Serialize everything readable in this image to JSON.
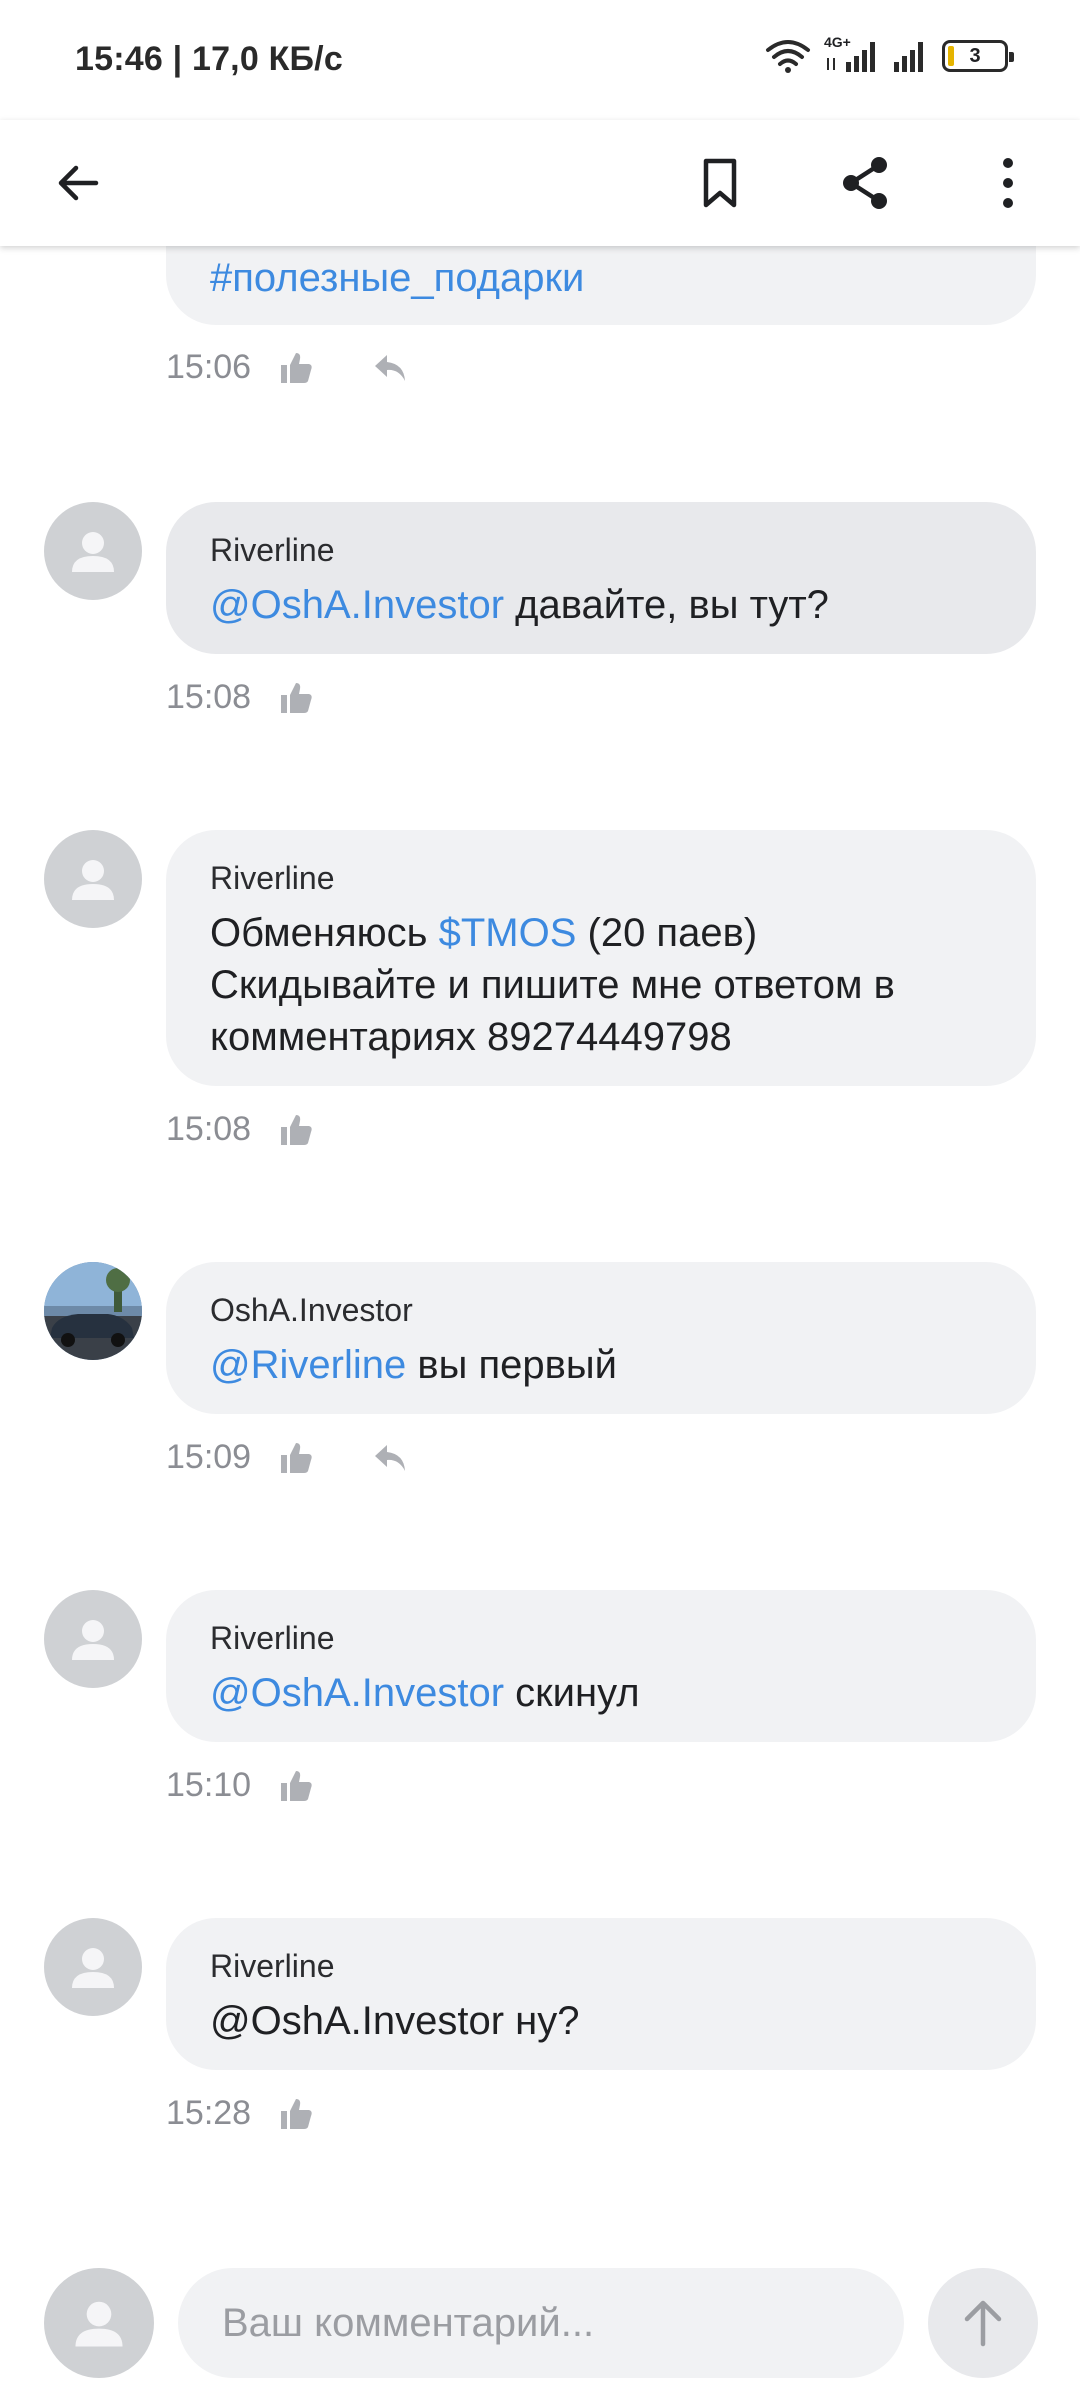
{
  "status_bar": {
    "time_speed": "15:46 | 17,0 КБ/с",
    "network": "4G+",
    "battery": "3"
  },
  "toolbar": {
    "back_icon": "arrow-left-icon",
    "bookmark_icon": "bookmark-icon",
    "share_icon": "share-icon",
    "more_icon": "more-vertical-icon"
  },
  "top_partial": {
    "hashtag": "#полезные_подарки",
    "time": "15:06"
  },
  "comments": [
    {
      "author": "Riverline",
      "mention": "@OshA.Investor",
      "text": " давайте, вы тут?",
      "time": "15:08"
    },
    {
      "author": "Riverline",
      "pre": "Обменяюсь ",
      "ticker": "$TMOS",
      "post": " (20 паев) Скидывайте и пишите мне ответом в комментариях 89274449798",
      "time": "15:08"
    },
    {
      "author": "OshA.Investor",
      "mention": "@Riverline",
      "text": " вы первый",
      "time": "15:09"
    },
    {
      "author": "Riverline",
      "mention": "@OshA.Investor",
      "text": " скинул",
      "time": "15:10"
    },
    {
      "author": "Riverline",
      "text": "@OshA.Investor ну?",
      "time": "15:28"
    }
  ],
  "composer": {
    "placeholder": "Ваш комментарий..."
  },
  "colors": {
    "link": "#3d8ae0",
    "bubble": "#f1f2f4",
    "bubble_highlight": "#e8e9ec"
  }
}
